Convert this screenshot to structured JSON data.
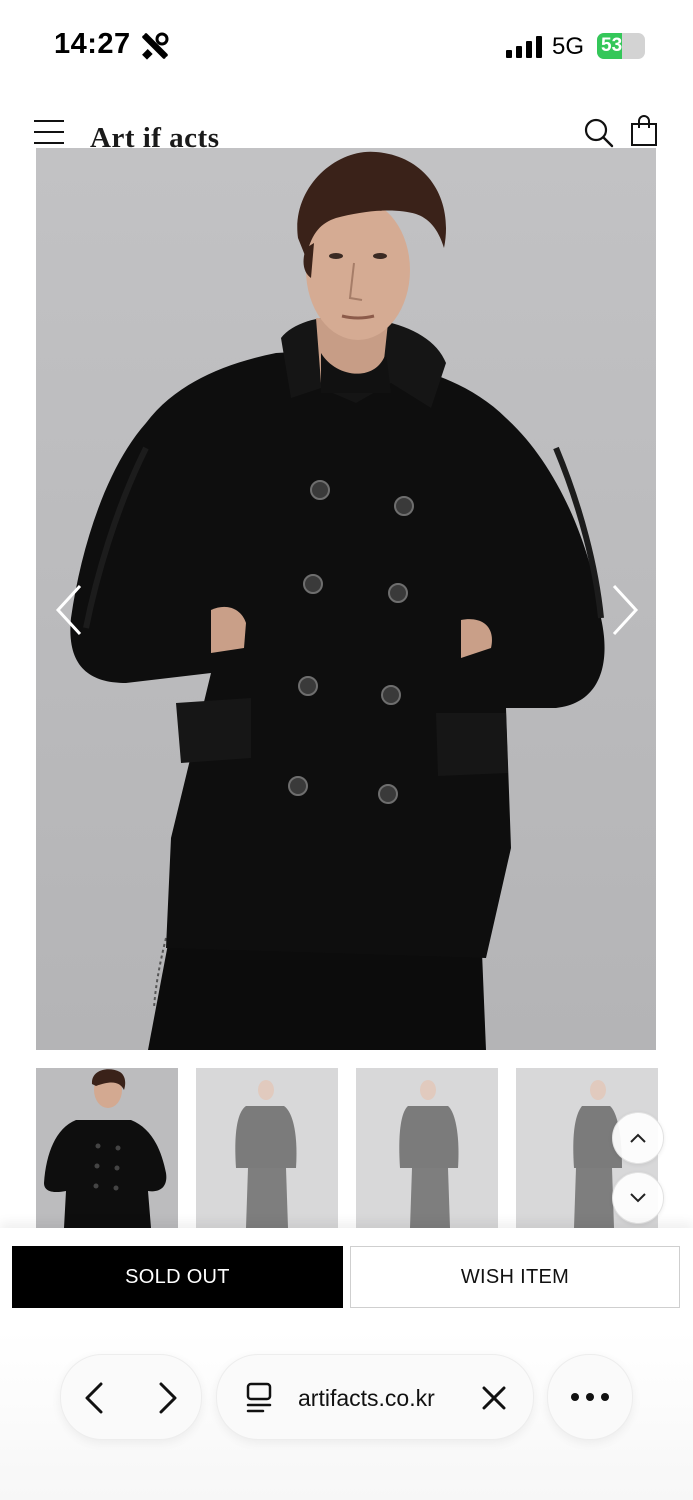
{
  "status_bar": {
    "time": "14:27",
    "network": "5G",
    "battery": "53",
    "battery_level": 0.53,
    "battery_color": "#34c759",
    "icons": [
      "tools-icon",
      "signal-icon",
      "battery-icon"
    ]
  },
  "header": {
    "logo": "Art if acts",
    "icons": [
      "menu-icon",
      "search-icon",
      "shopping-bag-icon"
    ]
  },
  "gallery": {
    "icons": [
      "chevron-left-icon",
      "chevron-right-icon"
    ],
    "thumbnail_count": 4,
    "selected_thumbnail": 1
  },
  "scroll": {
    "icons": [
      "chevron-up-icon",
      "chevron-down-icon"
    ]
  },
  "actions": {
    "sold_out_label": "SOLD OUT",
    "wish_item_label": "WISH ITEM"
  },
  "browser": {
    "url": "artifacts.co.kr",
    "icons": [
      "back-icon",
      "forward-icon",
      "tabs-icon",
      "close-icon",
      "more-icon"
    ]
  }
}
